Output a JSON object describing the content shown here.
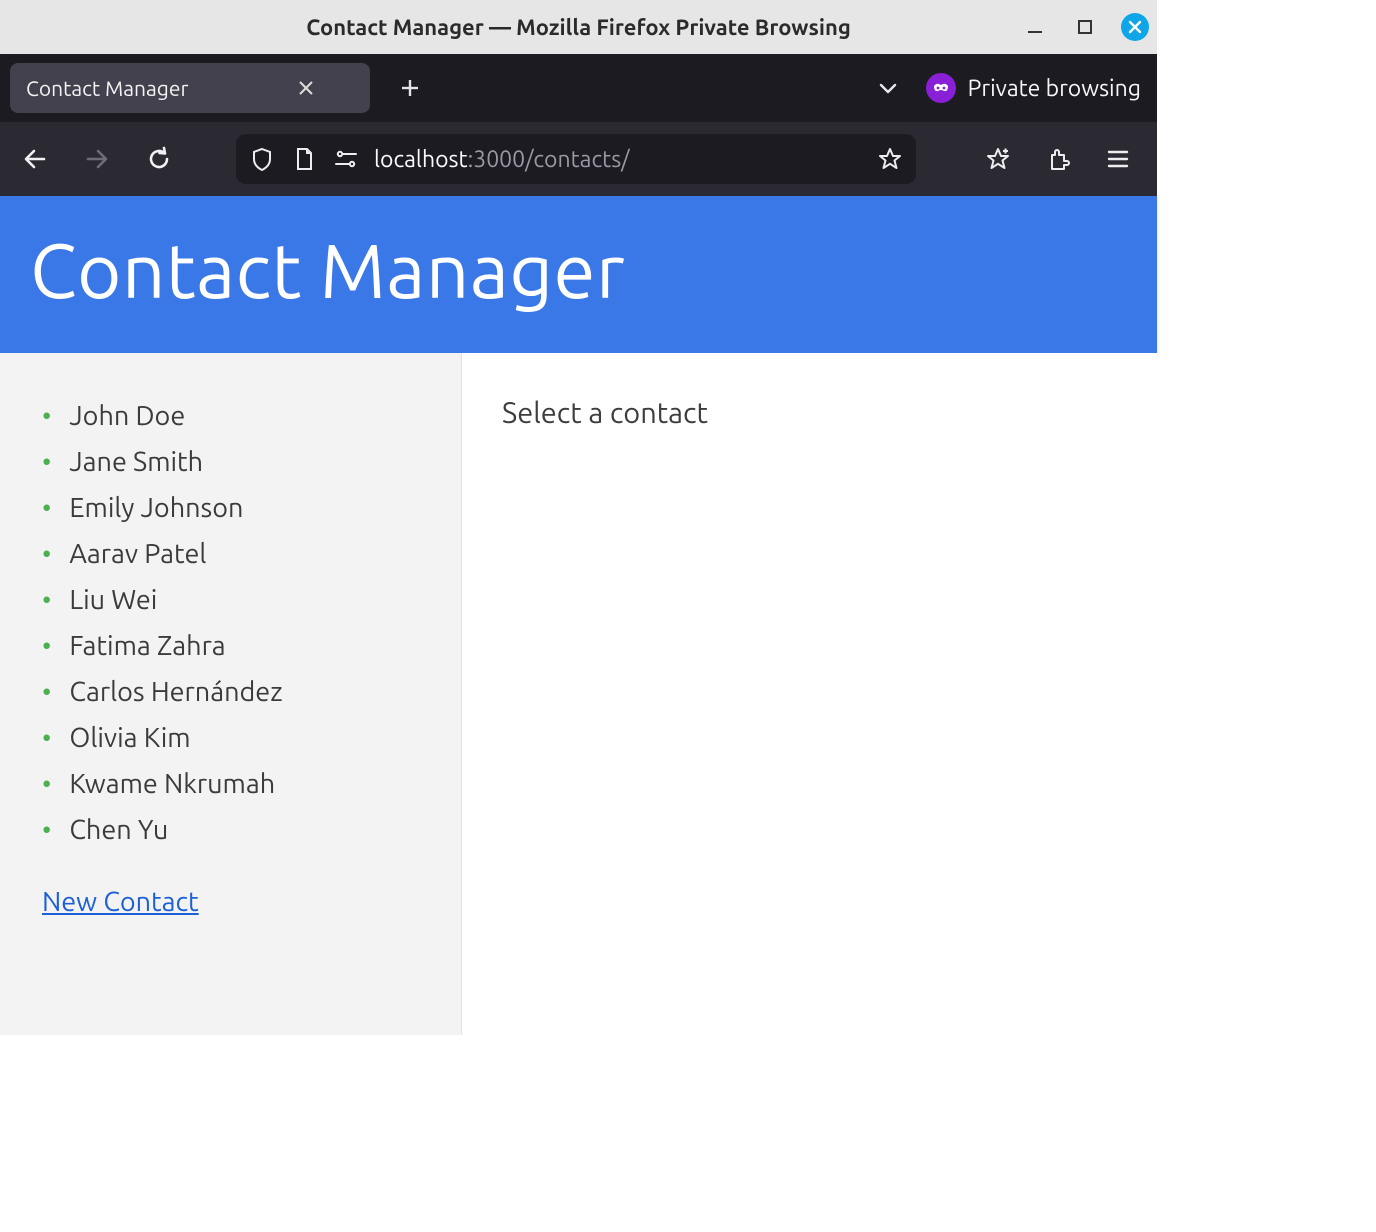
{
  "window": {
    "title": "Contact Manager — Mozilla Firefox Private Browsing"
  },
  "browser": {
    "tab_title": "Contact Manager",
    "private_label": "Private browsing",
    "url_host": "localhost",
    "url_path": ":3000/contacts/"
  },
  "app": {
    "title": "Contact Manager",
    "detail_placeholder": "Select a contact",
    "new_contact_label": "New Contact",
    "contacts": [
      "John Doe",
      "Jane Smith",
      "Emily Johnson",
      "Aarav Patel",
      "Liu Wei",
      "Fatima Zahra",
      "Carlos Hernández",
      "Olivia Kim",
      "Kwame Nkrumah",
      "Chen Yu"
    ]
  }
}
